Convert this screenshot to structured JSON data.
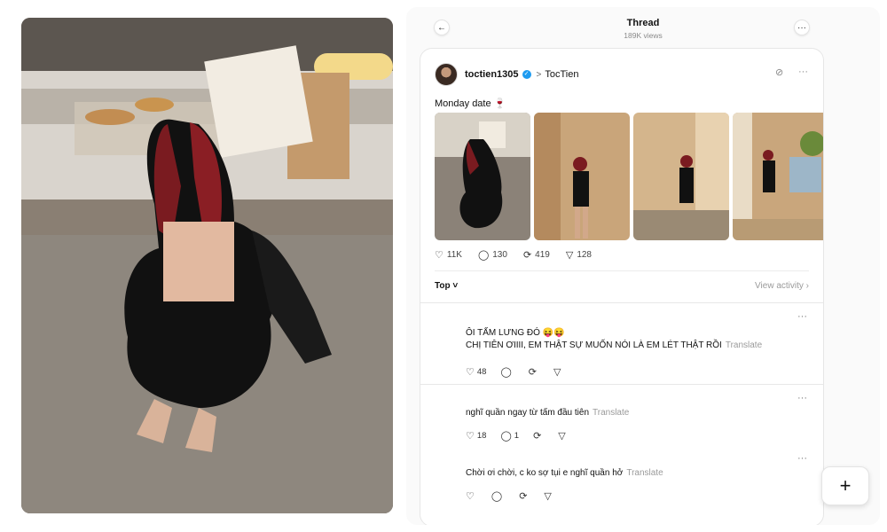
{
  "header": {
    "title": "Thread",
    "views": "189K views",
    "back_icon": "←",
    "more_icon": "···"
  },
  "post": {
    "username": "toctien1305",
    "verified_icon": "✓",
    "chevron": ">",
    "topic": "TocTien",
    "caption": "Monday date 🍷",
    "likes": "11K",
    "comments": "130",
    "reposts": "419",
    "shares": "128",
    "icons": {
      "like": "♡",
      "comment": "◯",
      "repost": "⟳",
      "share": "▽"
    }
  },
  "sort": {
    "label": "Top ˅",
    "view_activity": "View activity ›"
  },
  "replies": [
    {
      "line1": "ÔI TẤM LƯNG ĐÓ 😝😝",
      "line2": "CHỊ TIÊN ƠIIII, EM THẬT SỰ MUỐN NÓI LÀ EM LÉT THẬT RỒI",
      "translate": "Translate",
      "likes": "48",
      "comments": "",
      "more": "···"
    },
    {
      "line1": "nghĩ quần ngay từ tấm đầu tiên",
      "translate": "Translate",
      "likes": "18",
      "comments": "1",
      "more": "···"
    },
    {
      "line1": "Chời ơi chời, c ko sợ tụi e nghĩ quần hở",
      "translate": "Translate",
      "likes": "",
      "comments": "",
      "more": "···"
    }
  ],
  "fab": {
    "label": "+"
  },
  "colors": {
    "verified": "#1d9bf0",
    "muted": "#9a9a9a"
  }
}
